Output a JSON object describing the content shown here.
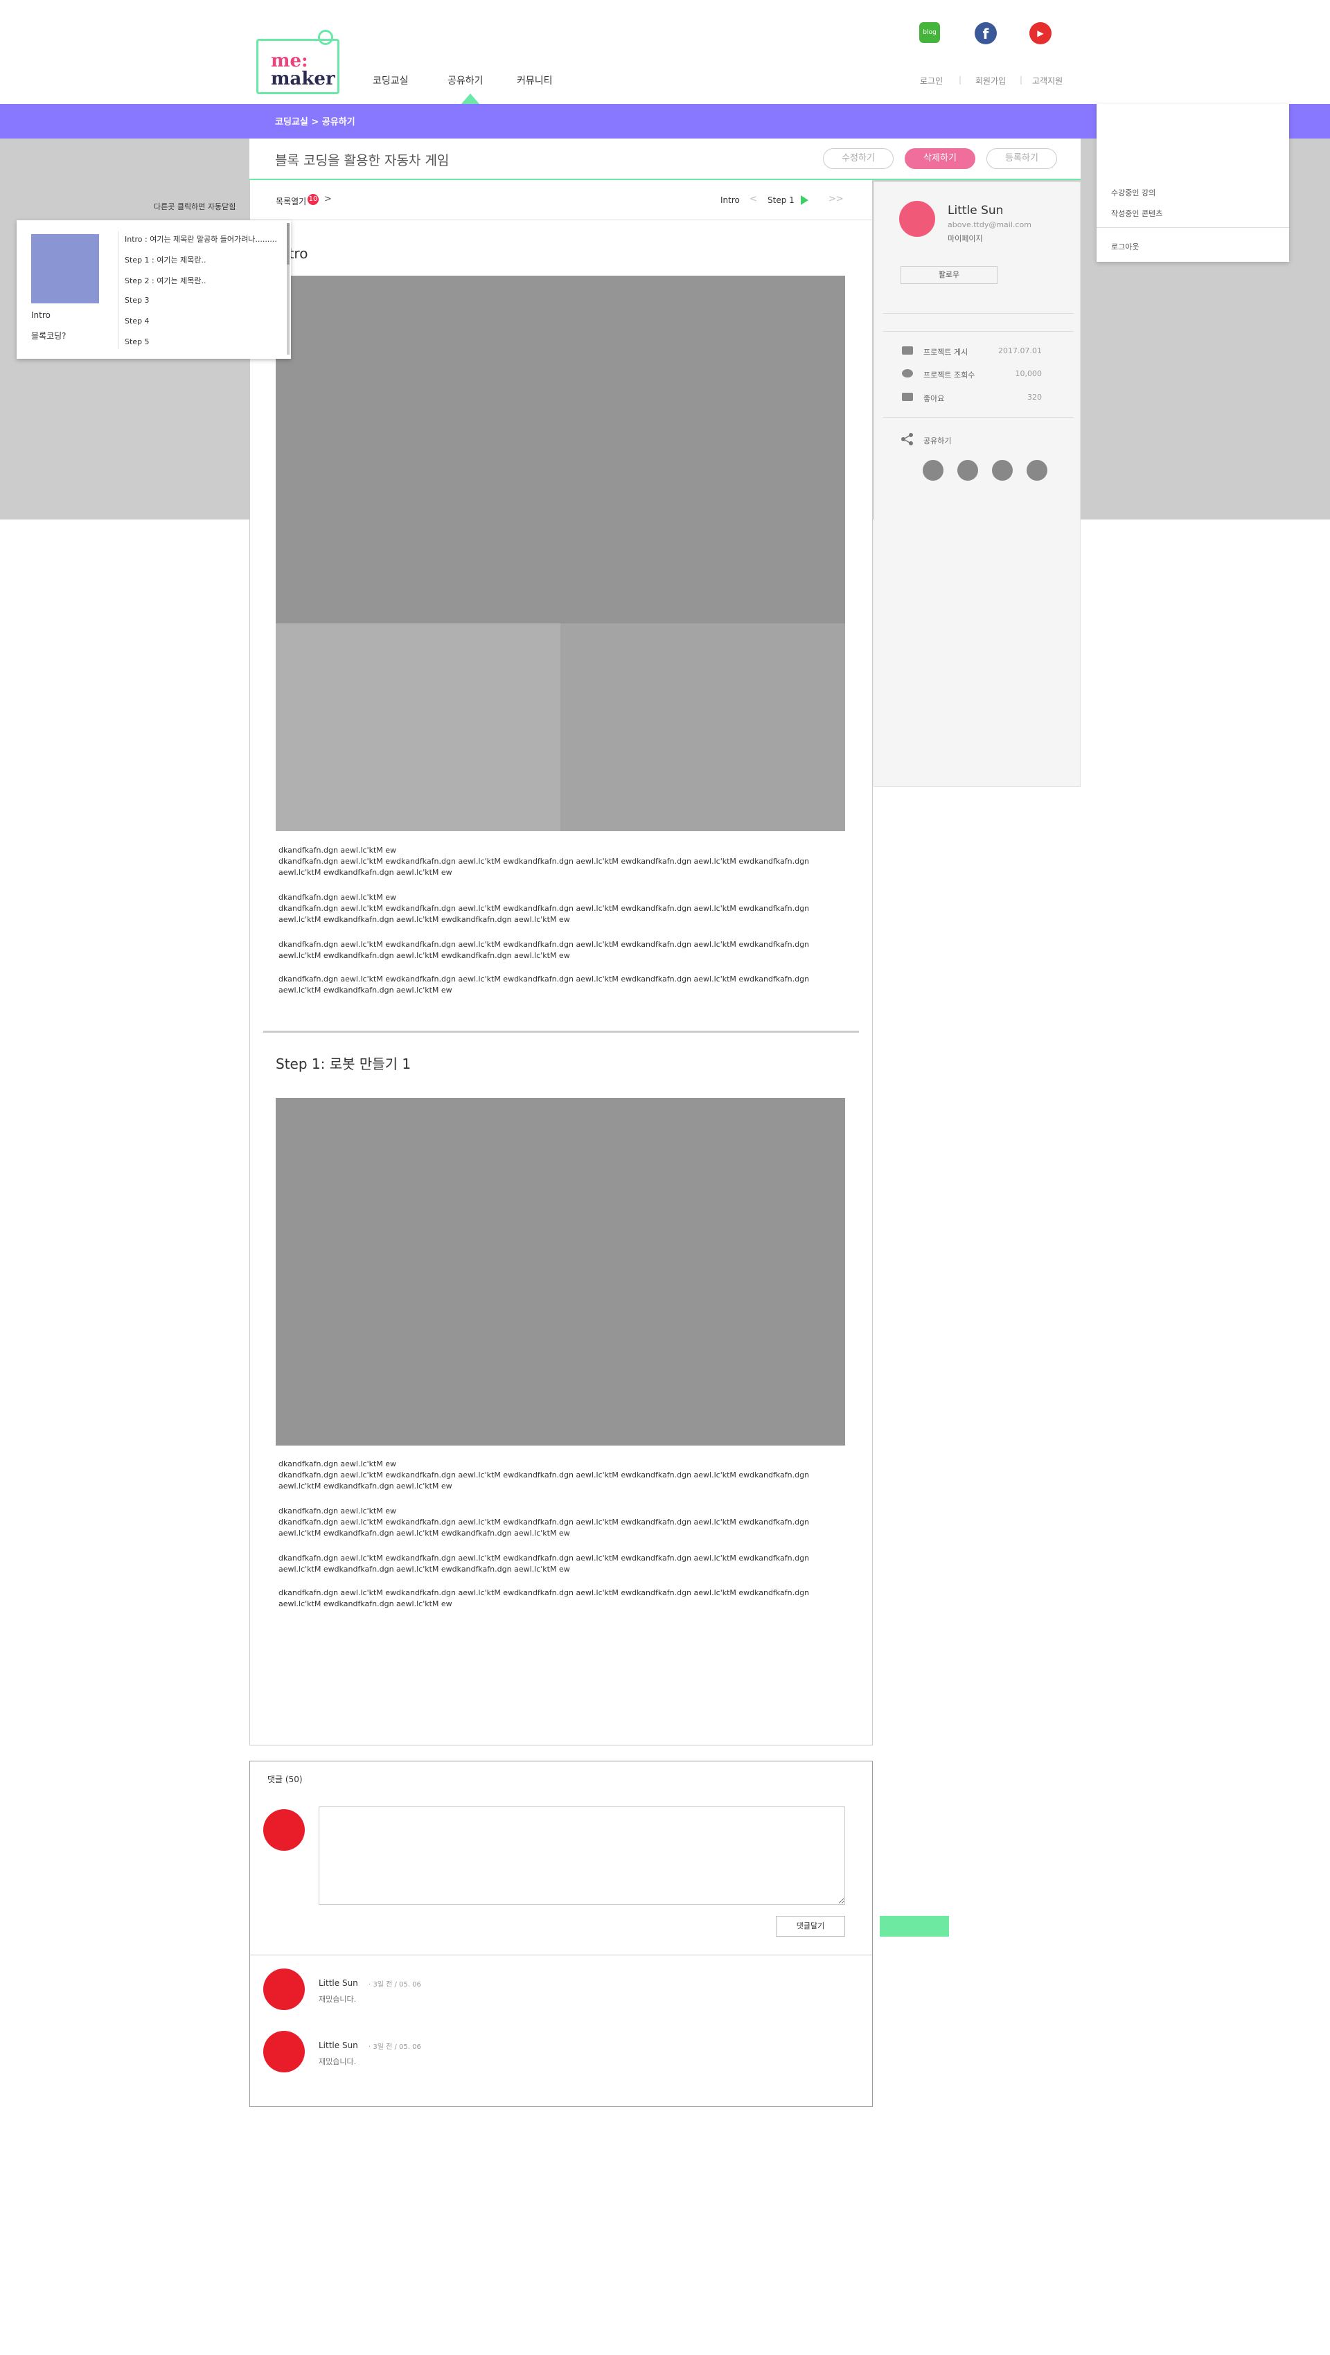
{
  "header": {
    "logo_top": "me:",
    "logo_bottom": "maker",
    "nav": [
      "코딩교실",
      "공유하기",
      "커뮤니티"
    ],
    "sns": [
      {
        "name": "blog-icon",
        "label": "blog",
        "color": "#44b53a"
      },
      {
        "name": "facebook-icon",
        "label": "f",
        "color": "#3b5998"
      },
      {
        "name": "youtube-icon",
        "label": "▶",
        "color": "#e62e2e"
      }
    ],
    "util": [
      "로그인",
      "회원가입",
      "고객지원"
    ],
    "sep": "|"
  },
  "breadcrumb": "코딩교실 > 공유하기",
  "project": {
    "title": "블록 코딩을 활용한 자동차 게임",
    "btn_edit": "수정하기",
    "btn_delete": "삭제하기",
    "btn_register": "등록하기"
  },
  "toc": {
    "open_label": "목록열기",
    "badge": "10",
    "chevron": ">",
    "nav_intro": "Intro",
    "nav_prev": "<",
    "nav_step": "Step 1",
    "nav_next": ">>",
    "thumb_intro": "Intro",
    "thumb_question": "블록코딩?",
    "items": [
      "Intro : 여기는 제목란 말공하 들어가려나.........",
      "Step 1 : 여기는 제목란..",
      "Step 2 : 여기는 제목란..",
      "Step 3",
      "Step 4",
      "Step 5"
    ],
    "side_label": "다른곳 클릭하면 자동닫힘"
  },
  "intro": {
    "title": "Intro",
    "paragraphs": [
      "dkandfkafn.dgn aewl.lc'ktM ew\ndkandfkafn.dgn aewl.lc'ktM ewdkandfkafn.dgn aewl.lc'ktM ewdkandfkafn.dgn aewl.lc'ktM ewdkandfkafn.dgn aewl.lc'ktM ewdkandfkafn.dgn\naewl.lc'ktM ewdkandfkafn.dgn aewl.lc'ktM ew",
      "dkandfkafn.dgn aewl.lc'ktM ew\ndkandfkafn.dgn aewl.lc'ktM ewdkandfkafn.dgn aewl.lc'ktM ewdkandfkafn.dgn aewl.lc'ktM ewdkandfkafn.dgn aewl.lc'ktM ewdkandfkafn.dgn\naewl.lc'ktM ewdkandfkafn.dgn aewl.lc'ktM ewdkandfkafn.dgn aewl.lc'ktM ew",
      "dkandfkafn.dgn aewl.lc'ktM ewdkandfkafn.dgn aewl.lc'ktM ewdkandfkafn.dgn aewl.lc'ktM ewdkandfkafn.dgn aewl.lc'ktM ewdkandfkafn.dgn\naewl.lc'ktM ewdkandfkafn.dgn aewl.lc'ktM ewdkandfkafn.dgn aewl.lc'ktM ew",
      "dkandfkafn.dgn aewl.lc'ktM ewdkandfkafn.dgn aewl.lc'ktM ewdkandfkafn.dgn aewl.lc'ktM ewdkandfkafn.dgn aewl.lc'ktM ewdkandfkafn.dgn\naewl.lc'ktM ewdkandfkafn.dgn aewl.lc'ktM ew"
    ]
  },
  "step1": {
    "title": "Step 1: 로봇 만들기 1",
    "paragraphs": [
      "dkandfkafn.dgn aewl.lc'ktM ew\ndkandfkafn.dgn aewl.lc'ktM ewdkandfkafn.dgn aewl.lc'ktM ewdkandfkafn.dgn aewl.lc'ktM ewdkandfkafn.dgn aewl.lc'ktM ewdkandfkafn.dgn\naewl.lc'ktM ewdkandfkafn.dgn aewl.lc'ktM ew",
      "dkandfkafn.dgn aewl.lc'ktM ew\ndkandfkafn.dgn aewl.lc'ktM ewdkandfkafn.dgn aewl.lc'ktM ewdkandfkafn.dgn aewl.lc'ktM ewdkandfkafn.dgn aewl.lc'ktM ewdkandfkafn.dgn\naewl.lc'ktM ewdkandfkafn.dgn aewl.lc'ktM ewdkandfkafn.dgn aewl.lc'ktM ew",
      "dkandfkafn.dgn aewl.lc'ktM ewdkandfkafn.dgn aewl.lc'ktM ewdkandfkafn.dgn aewl.lc'ktM ewdkandfkafn.dgn aewl.lc'ktM ewdkandfkafn.dgn\naewl.lc'ktM ewdkandfkafn.dgn aewl.lc'ktM ewdkandfkafn.dgn aewl.lc'ktM ew",
      "dkandfkafn.dgn aewl.lc'ktM ewdkandfkafn.dgn aewl.lc'ktM ewdkandfkafn.dgn aewl.lc'ktM ewdkandfkafn.dgn aewl.lc'ktM ewdkandfkafn.dgn\naewl.lc'ktM ewdkandfkafn.dgn aewl.lc'ktM ew"
    ]
  },
  "profile": {
    "name": "Little Sun",
    "email": "above.ttdy@mail.com",
    "mypage": "마이페이지",
    "follow": "팔로우",
    "stats": [
      {
        "label": "프로젝트 게시",
        "value": "2017.07.01",
        "icon": "calendar-icon"
      },
      {
        "label": "프로젝트 조회수",
        "value": "10,000",
        "icon": "eye-icon"
      },
      {
        "label": "좋아요",
        "value": "320",
        "icon": "thumbs-up-icon"
      }
    ],
    "share": "공유하기"
  },
  "user_menu": {
    "items": [
      "수강중인 강의",
      "작성중인 콘텐츠"
    ],
    "logout": "로그아웃"
  },
  "comments": {
    "count_label": "댓글 (50)",
    "submit": "댓글달기",
    "list": [
      {
        "name": "Little Sun",
        "meta": "· 3일 전 / 05. 06",
        "text": "재밌습니다."
      },
      {
        "name": "Little Sun",
        "meta": "· 3일 전 / 05. 06",
        "text": "재밌습니다."
      }
    ]
  }
}
